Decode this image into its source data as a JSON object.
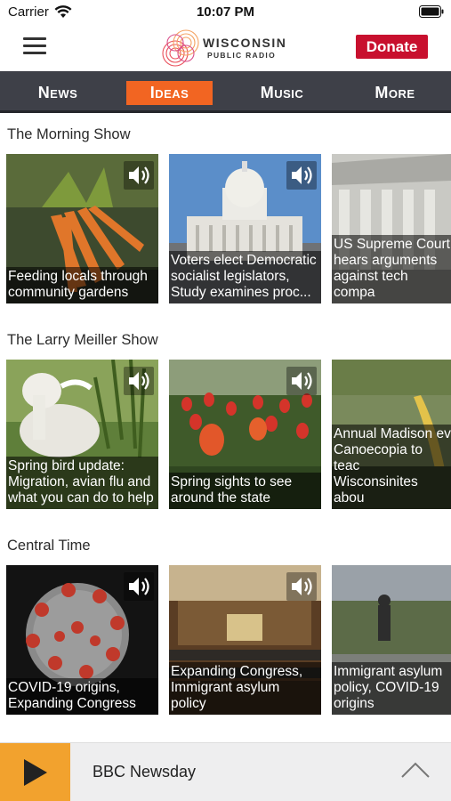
{
  "status_bar": {
    "carrier": "Carrier",
    "time": "10:07 PM"
  },
  "header": {
    "logo_title": "WISCONSIN",
    "logo_subtitle": "PUBLIC RADIO",
    "donate_label": "Donate",
    "accent_color": "#c8102e"
  },
  "nav": {
    "tabs": [
      {
        "label": "News",
        "active": false
      },
      {
        "label": "Ideas",
        "active": true
      },
      {
        "label": "Music",
        "active": false
      },
      {
        "label": "More",
        "active": false
      }
    ],
    "active_color": "#f26522",
    "bar_color": "#3e4048"
  },
  "sections": [
    {
      "title": "The Morning Show",
      "cards": [
        {
          "caption": "Feeding locals through\ncommunity gardens",
          "has_audio": true
        },
        {
          "caption": "Voters elect Democratic\nsocialist legislators,\nStudy examines proc...",
          "has_audio": true
        },
        {
          "caption": "US Supreme Court\nhears arguments\nagainst tech compa",
          "has_audio": false
        }
      ]
    },
    {
      "title": "The Larry Meiller Show",
      "cards": [
        {
          "caption": "Spring bird update:\nMigration, avian flu and\nwhat you can do to help",
          "has_audio": true
        },
        {
          "caption": "Spring sights to see\naround the state",
          "has_audio": true
        },
        {
          "caption": "Annual Madison ev\nCanoecopia to teac\nWisconsinites abou",
          "has_audio": false
        }
      ]
    },
    {
      "title": "Central Time",
      "cards": [
        {
          "caption": "COVID-19 origins,\nExpanding Congress",
          "has_audio": true
        },
        {
          "caption": "Expanding Congress,\nImmigrant asylum\npolicy",
          "has_audio": true
        },
        {
          "caption": "Immigrant asylum\npolicy, COVID-19\norigins",
          "has_audio": false
        }
      ]
    }
  ],
  "player": {
    "title": "BBC Newsday",
    "play_color": "#f2a22e"
  }
}
